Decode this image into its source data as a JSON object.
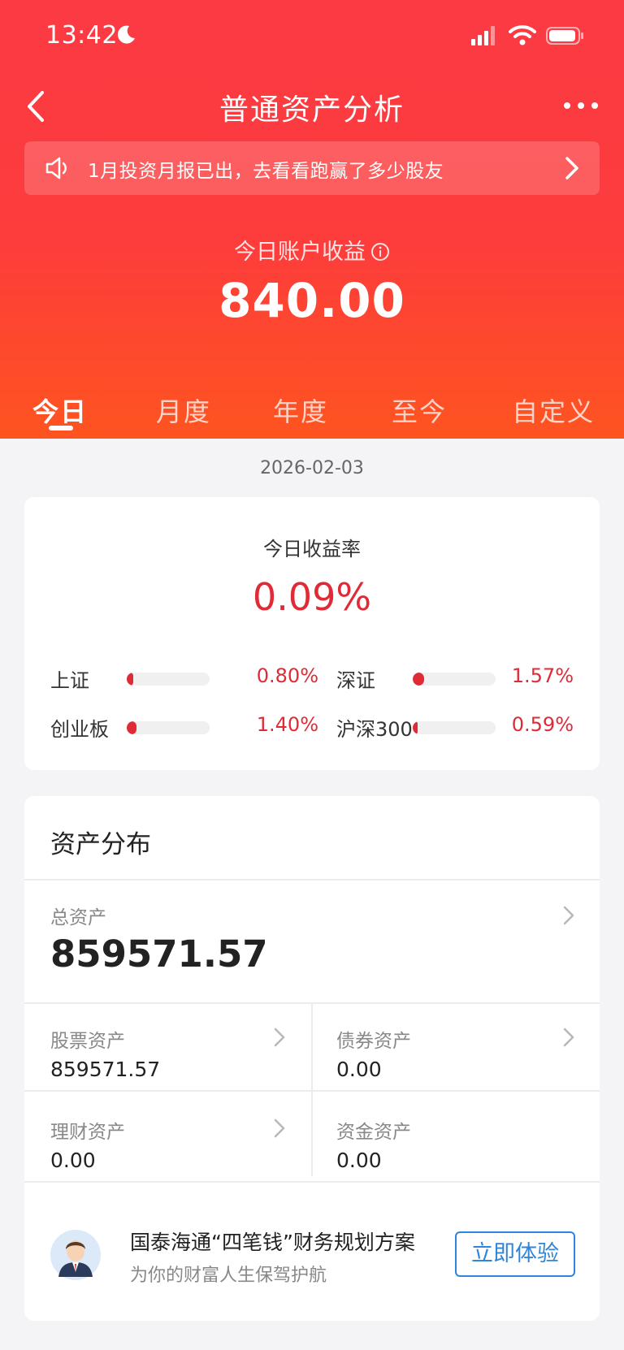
{
  "status": {
    "time": "13:42"
  },
  "nav": {
    "title": "普通资产分析"
  },
  "banner": {
    "text": "1月投资月报已出，去看看跑赢了多少股友"
  },
  "profit": {
    "label": "今日账户收益",
    "value": "840.00"
  },
  "tabs": [
    {
      "label": "今日",
      "active": true
    },
    {
      "label": "月度",
      "active": false
    },
    {
      "label": "年度",
      "active": false
    },
    {
      "label": "至今",
      "active": false
    },
    {
      "label": "自定义",
      "active": false
    }
  ],
  "date": "2026-02-03",
  "rate": {
    "label": "今日收益率",
    "value": "0.09%"
  },
  "indices": [
    {
      "name": "上证",
      "value": "0.80%",
      "level": 0.08
    },
    {
      "name": "深证",
      "value": "1.57%",
      "level": 0.14
    },
    {
      "name": "创业板",
      "value": "1.40%",
      "level": 0.12
    },
    {
      "name": "沪深300",
      "value": "0.59%",
      "level": 0.06
    }
  ],
  "assets": {
    "title": "资产分布",
    "total_label": "总资产",
    "total_value": "859571.57",
    "stock_label": "股票资产",
    "stock_value": "859571.57",
    "bond_label": "债券资产",
    "bond_value": "0.00",
    "wealth_label": "理财资产",
    "wealth_value": "0.00",
    "cash_label": "资金资产",
    "cash_value": "0.00"
  },
  "promo": {
    "title": "国泰海通“四笔钱”财务规划方案",
    "subtitle": "为你的财富人生保驾护航",
    "button": "立即体验"
  },
  "colors": {
    "header_red": "#fb3a44",
    "accent_red": "#e02b36",
    "link_blue": "#2f86d8"
  }
}
